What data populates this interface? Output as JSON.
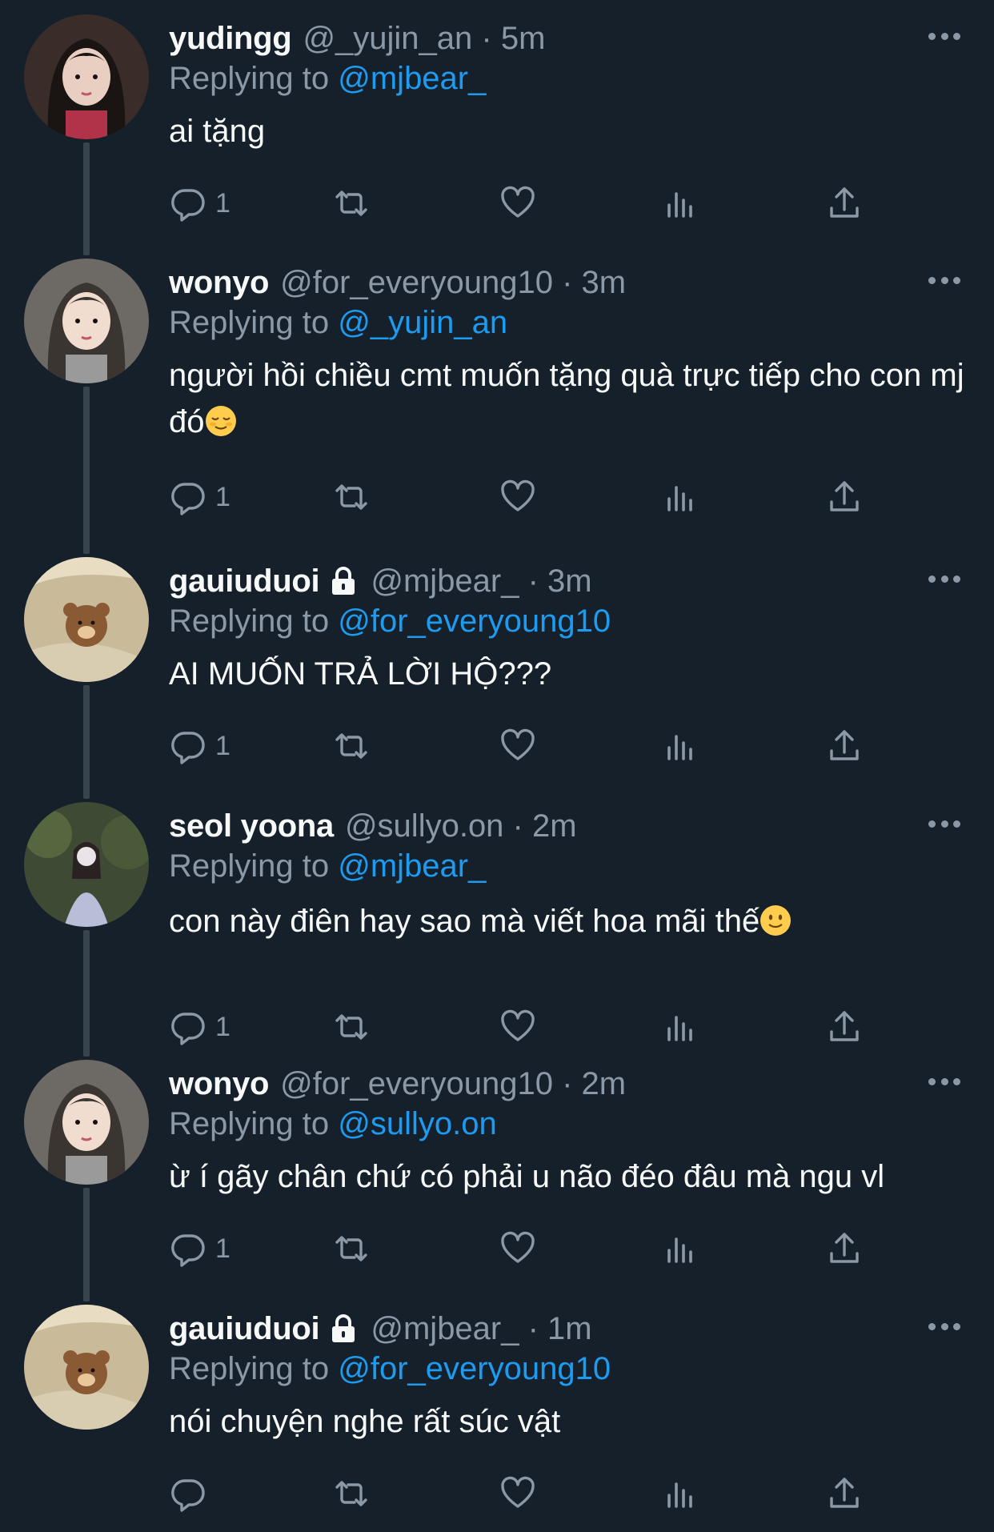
{
  "reply_prefix": "Replying to",
  "colors": {
    "background": "#15202b",
    "text_primary": "#f7f9f9",
    "text_secondary": "#8b98a5",
    "link": "#1d9bf0",
    "thread_line": "#38444d"
  },
  "icons": {
    "reply": "reply-bubble-icon",
    "retweet": "retweet-icon",
    "like": "heart-icon",
    "views": "views-chart-icon",
    "share": "share-icon",
    "more": "more-dots-icon",
    "protected": "lock-icon"
  },
  "tweets": [
    {
      "display_name": "yudingg",
      "meta": "@_yujin_an · 5m",
      "protected": false,
      "replying_to": "@mjbear_",
      "text": "ai tặng",
      "emoji": null,
      "reply_count": "1"
    },
    {
      "display_name": "wonyo",
      "meta": "@for_everyoung10 · 3m",
      "protected": false,
      "replying_to": "@_yujin_an",
      "text": "người hồi chiều cmt muốn tặng quà trực tiếp cho con mj đó",
      "emoji": "relieved-face-emoji",
      "reply_count": "1"
    },
    {
      "display_name": "gauiuduoi",
      "meta": "@mjbear_ · 3m",
      "protected": true,
      "replying_to": "@for_everyoung10",
      "text": "AI MUỐN TRẢ LỜI HỘ???",
      "emoji": null,
      "reply_count": "1"
    },
    {
      "display_name": "seol yoona",
      "meta": "@sullyo.on · 2m",
      "protected": false,
      "replying_to": "@mjbear_",
      "text": "con này điên hay sao mà viết hoa mãi thế",
      "emoji": "slightly-smiling-face-emoji",
      "reply_count": "1"
    },
    {
      "display_name": "wonyo",
      "meta": "@for_everyoung10 · 2m",
      "protected": false,
      "replying_to": "@sullyo.on",
      "text": "ừ í gãy chân chứ có phải u não đéo đâu mà ngu vl",
      "emoji": null,
      "reply_count": "1"
    },
    {
      "display_name": "gauiuduoi",
      "meta": "@mjbear_ · 1m",
      "protected": true,
      "replying_to": "@for_everyoung10",
      "text": "nói chuyện nghe rất súc vật",
      "emoji": null,
      "reply_count": ""
    }
  ]
}
